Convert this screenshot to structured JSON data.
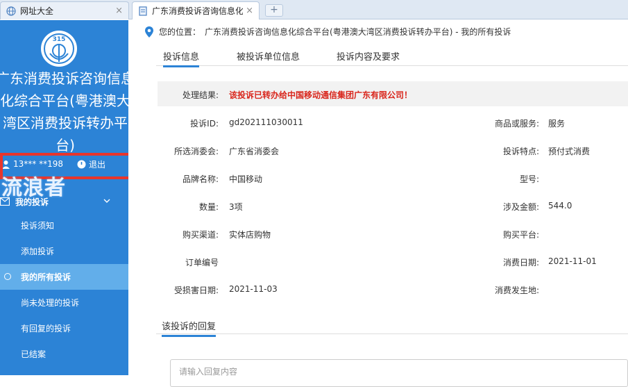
{
  "browser": {
    "tabs": [
      {
        "label": "网址大全",
        "close": "×"
      },
      {
        "label": "广东消费投诉咨询信息化",
        "close": "×"
      }
    ],
    "new_tab": "+"
  },
  "sidebar": {
    "platform_title": "广东消费投诉咨询信息化综合平台(粤港澳大湾区消费投诉转办平台)",
    "user_phone": "13*** **198",
    "logout": "退出",
    "watermark": "流浪者",
    "menu_header": "我的投诉",
    "items": [
      {
        "label": "投诉须知"
      },
      {
        "label": "添加投诉"
      },
      {
        "label": "我的所有投诉"
      },
      {
        "label": "尚未处理的投诉"
      },
      {
        "label": "有回复的投诉"
      },
      {
        "label": "已结案"
      }
    ],
    "bg_color": "#2c83d6",
    "active_color": "#62aeea"
  },
  "main": {
    "location_label": "您的位置：",
    "location_path": "广东消费投诉咨询信息化综合平台(粤港澳大湾区消费投诉转办平台)  - 我的所有投诉",
    "tabs": [
      {
        "label": "投诉信息"
      },
      {
        "label": "被投诉单位信息"
      },
      {
        "label": "投诉内容及要求"
      }
    ],
    "result": {
      "label": "处理结果:",
      "value": "该投诉已转办给中国移动通信集团广东有限公司！"
    },
    "fields": {
      "complaint_id": {
        "label": "投诉ID:",
        "value": "gd202111030011"
      },
      "goods_service": {
        "label": "商品或服务:",
        "value": "服务"
      },
      "consumer_council": {
        "label": "所选消委会:",
        "value": "广东省消委会"
      },
      "complaint_feature": {
        "label": "投诉特点:",
        "value": "预付式消费"
      },
      "brand": {
        "label": "品牌名称:",
        "value": "中国移动"
      },
      "model": {
        "label": "型号:",
        "value": ""
      },
      "quantity": {
        "label": "数量:",
        "value": "3项"
      },
      "amount": {
        "label": "涉及金额:",
        "value": "544.0"
      },
      "channel": {
        "label": "购买渠道:",
        "value": "实体店购物"
      },
      "platform": {
        "label": "购买平台:",
        "value": ""
      },
      "order_no": {
        "label": "订单编号",
        "value": ""
      },
      "consume_date": {
        "label": "消费日期:",
        "value": "2021-11-01"
      },
      "damage_date": {
        "label": "受损害日期:",
        "value": "2021-11-03"
      },
      "consume_place": {
        "label": "消费发生地:",
        "value": ""
      }
    },
    "reply_tab": "该投诉的回复",
    "reply_placeholder": "请输入回复内容",
    "accent_color": "#2c83d6",
    "result_color": "#d9261c"
  }
}
